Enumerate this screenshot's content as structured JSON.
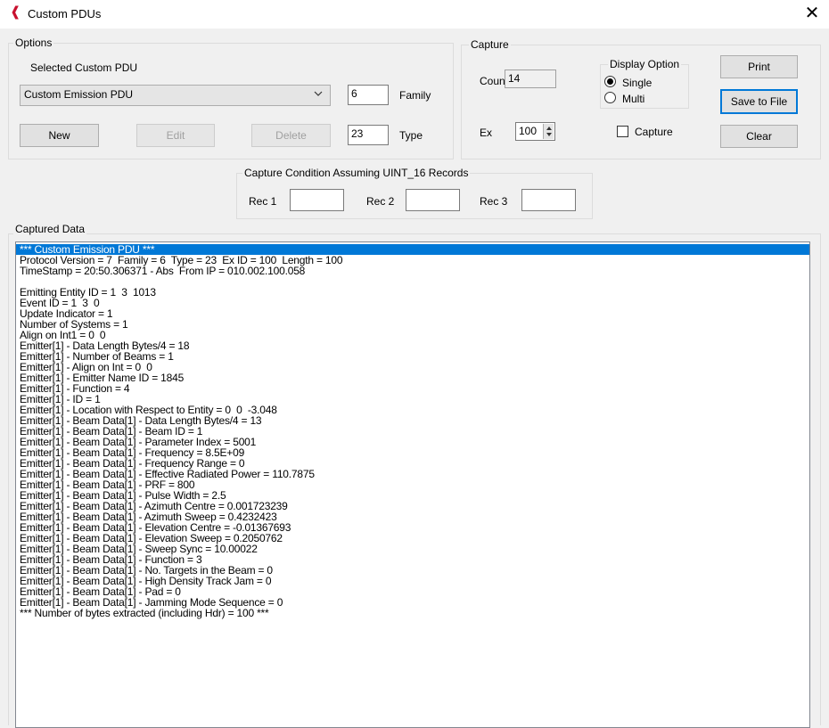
{
  "window": {
    "title": "Custom PDUs",
    "close": "✕",
    "icon": "app-logo-icon"
  },
  "options": {
    "legend": "Options",
    "selected_label": "Selected Custom PDU",
    "pdu_select": "Custom Emission PDU",
    "family_value": "6",
    "family_label": "Family",
    "type_value": "23",
    "type_label": "Type",
    "buttons": {
      "new": "New",
      "edit": "Edit",
      "delete": "Delete"
    }
  },
  "capture": {
    "legend": "Capture",
    "count_label": "Count",
    "count_value": "14",
    "ex_label": "Ex",
    "ex_value": "100",
    "display_option": {
      "legend": "Display Option",
      "single": "Single",
      "multi": "Multi",
      "selected": "Single"
    },
    "capture_checkbox": "Capture",
    "buttons": {
      "print": "Print",
      "save": "Save to File",
      "clear": "Clear"
    }
  },
  "condition": {
    "legend": "Capture Condition Assuming UINT_16 Records",
    "rec1_label": "Rec 1",
    "rec2_label": "Rec 2",
    "rec3_label": "Rec 3"
  },
  "captured": {
    "legend": "Captured Data",
    "lines": [
      "*** Custom Emission PDU ***",
      "Protocol Version = 7  Family = 6  Type = 23  Ex ID = 100  Length = 100",
      "TimeStamp = 20:50.306371 - Abs  From IP = 010.002.100.058",
      "",
      "Emitting Entity ID = 1  3  1013",
      "Event ID = 1  3  0",
      "Update Indicator = 1",
      "Number of Systems = 1",
      "Align on Int1 = 0  0",
      "Emitter[1] - Data Length Bytes/4 = 18",
      "Emitter[1] - Number of Beams = 1",
      "Emitter[1] - Align on Int = 0  0",
      "Emitter[1] - Emitter Name ID = 1845",
      "Emitter[1] - Function = 4",
      "Emitter[1] - ID = 1",
      "Emitter[1] - Location with Respect to Entity = 0  0  -3.048",
      "Emitter[1] - Beam Data[1] - Data Length Bytes/4 = 13",
      "Emitter[1] - Beam Data[1] - Beam ID = 1",
      "Emitter[1] - Beam Data[1] - Parameter Index = 5001",
      "Emitter[1] - Beam Data[1] - Frequency = 8.5E+09",
      "Emitter[1] - Beam Data[1] - Frequency Range = 0",
      "Emitter[1] - Beam Data[1] - Effective Radiated Power = 110.7875",
      "Emitter[1] - Beam Data[1] - PRF = 800",
      "Emitter[1] - Beam Data[1] - Pulse Width = 2.5",
      "Emitter[1] - Beam Data[1] - Azimuth Centre = 0.001723239",
      "Emitter[1] - Beam Data[1] - Azimuth Sweep = 0.4232423",
      "Emitter[1] - Beam Data[1] - Elevation Centre = -0.01367693",
      "Emitter[1] - Beam Data[1] - Elevation Sweep = 0.2050762",
      "Emitter[1] - Beam Data[1] - Sweep Sync = 10.00022",
      "Emitter[1] - Beam Data[1] - Function = 3",
      "Emitter[1] - Beam Data[1] - No. Targets in the Beam = 0",
      "Emitter[1] - Beam Data[1] - High Density Track Jam = 0",
      "Emitter[1] - Beam Data[1] - Pad = 0",
      "Emitter[1] - Beam Data[1] - Jamming Mode Sequence = 0",
      "*** Number of bytes extracted (including Hdr) = 100 ***"
    ]
  }
}
